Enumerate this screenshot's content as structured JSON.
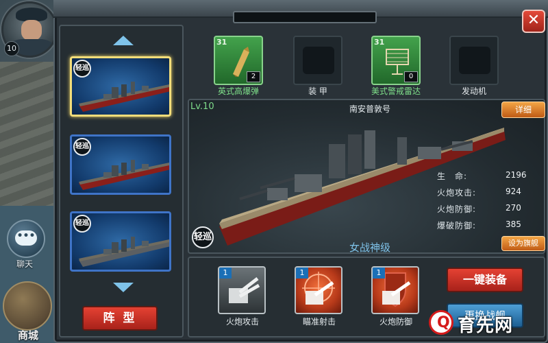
{
  "player": {
    "level": "10"
  },
  "sidebar": {
    "chat_label": "聊天",
    "shop_label": "商城"
  },
  "ship_list": {
    "cards": [
      {
        "class_tag": "轻巡",
        "selected": true
      },
      {
        "class_tag": "轻巡",
        "selected": false
      },
      {
        "class_tag": "轻巡",
        "selected": false
      }
    ],
    "formation_label": "阵 型"
  },
  "equipment": [
    {
      "label": "英式高爆弹",
      "level": "31",
      "count": "2",
      "state": "filled",
      "icon": "shell-icon",
      "label_color": "green"
    },
    {
      "label": "装 甲",
      "state": "empty",
      "icon": "armor-slot-icon",
      "label_color": "white"
    },
    {
      "label": "美式警戒雷达",
      "level": "31",
      "count": "0",
      "state": "filled",
      "icon": "radar-icon",
      "label_color": "green"
    },
    {
      "label": "发动机",
      "state": "empty",
      "icon": "engine-slot-icon",
      "label_color": "white"
    }
  ],
  "ship": {
    "level_text": "Lv.10",
    "name": "南安普敦号",
    "class_tag": "轻巡",
    "class_name": "女战神级",
    "detail_button": "详细",
    "flagship_button": "设为旗舰",
    "stats": [
      {
        "label": "生　命:",
        "value": "2196"
      },
      {
        "label": "火炮攻击:",
        "value": "924"
      },
      {
        "label": "火炮防御:",
        "value": "270"
      },
      {
        "label": "爆破防御:",
        "value": "385"
      }
    ]
  },
  "skills": [
    {
      "label": "火炮攻击",
      "level": "1",
      "style": "gray",
      "icon": "cannon-attack-icon"
    },
    {
      "label": "瞄准射击",
      "level": "1",
      "style": "red",
      "icon": "aim-shot-icon"
    },
    {
      "label": "火炮防御",
      "level": "1",
      "style": "red",
      "icon": "cannon-defense-icon"
    }
  ],
  "actions": {
    "one_key_equip": "一键装备",
    "change_ship": "更换战舰"
  },
  "watermark": {
    "text": "育先网"
  },
  "colors": {
    "accent_red": "#d6382a",
    "accent_blue": "#7fc3ea",
    "equip_green": "#43a24c",
    "level_green": "#7fdd8b"
  }
}
